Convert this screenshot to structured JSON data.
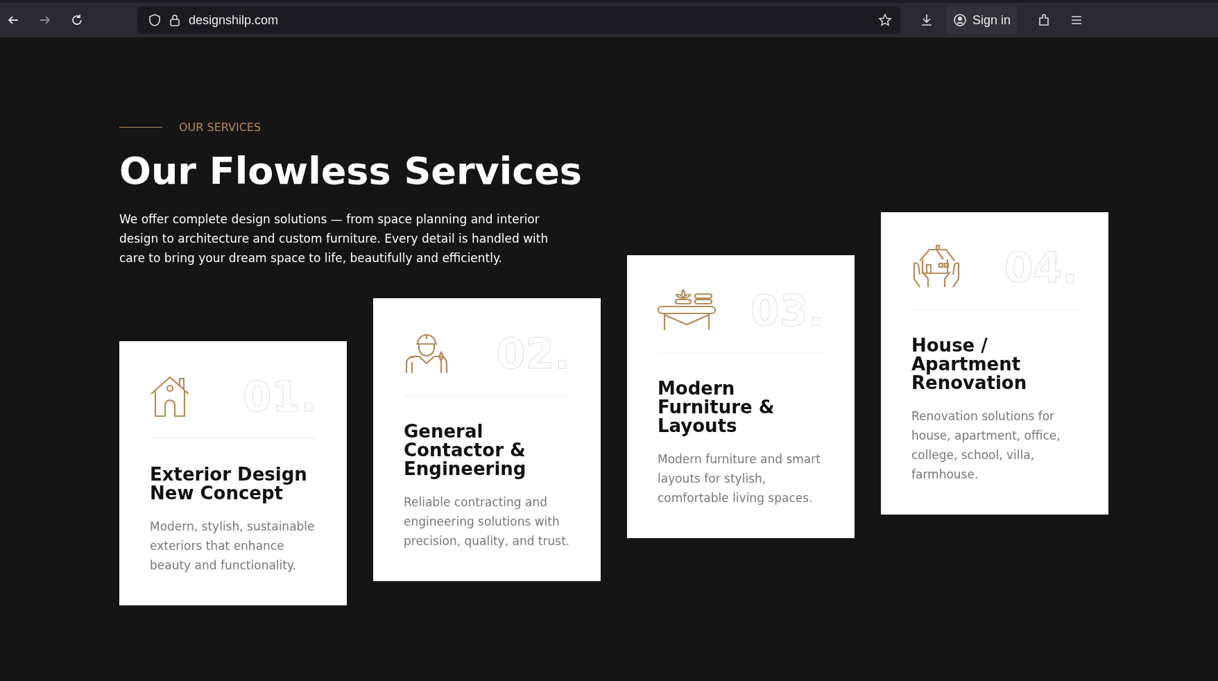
{
  "browser": {
    "url": "designshilp.com",
    "sign_in": "Sign in"
  },
  "section": {
    "eyebrow": "OUR SERVICES",
    "title": "Our Flowless Services",
    "description": "We offer complete design solutions — from space planning and interior design to architecture and custom furniture. Every detail is handled with care to bring your dream space to life, beautifully and efficiently."
  },
  "services": [
    {
      "kind": "house",
      "number": "01.",
      "title": "Exterior Design New Concept",
      "description": "Modern, stylish, sustainable exteriors that enhance beauty and functionality."
    },
    {
      "kind": "worker",
      "number": "02.",
      "title": "General Contactor & Engineering",
      "description": "Reliable contracting and engineering solutions with precision, quality, and trust."
    },
    {
      "kind": "furniture",
      "number": "03.",
      "title": "Modern Furniture & Layouts",
      "description": "Modern furniture and smart layouts for stylish, comfortable living spaces."
    },
    {
      "kind": "hands",
      "number": "04.",
      "title": "House / Apartment Renovation",
      "description": "Renovation solutions for house, apartment, office, college, school, villa, farmhouse."
    }
  ]
}
